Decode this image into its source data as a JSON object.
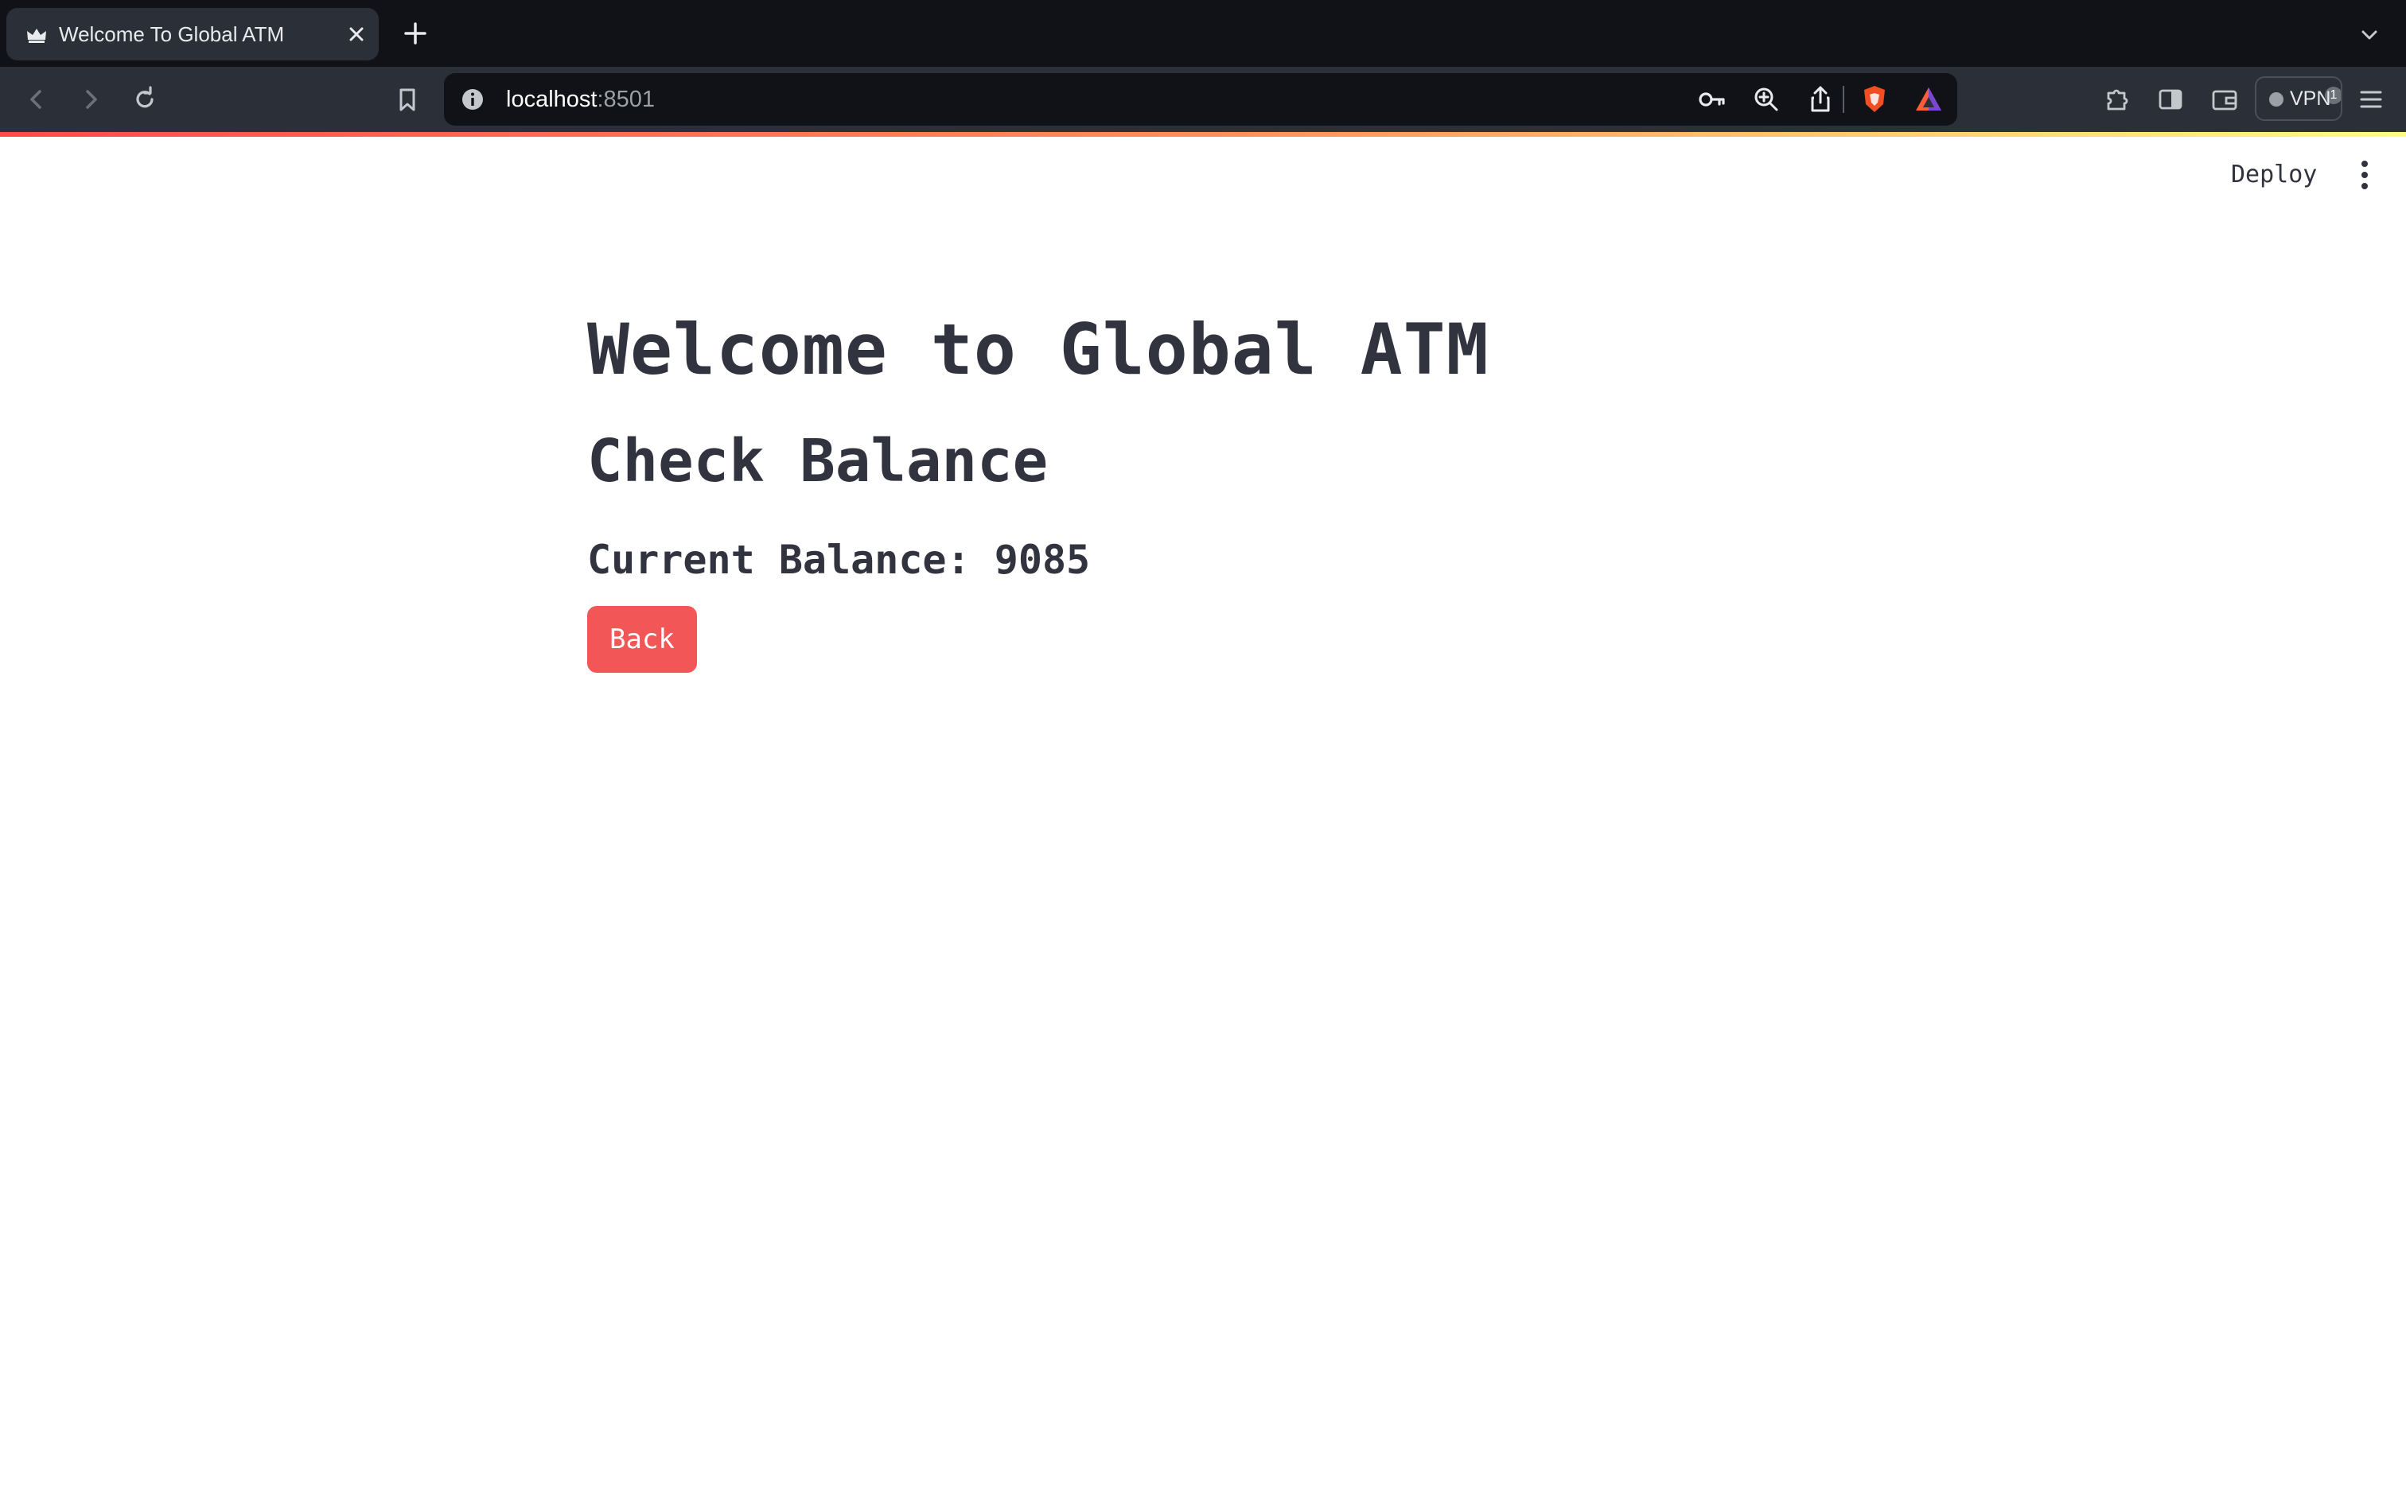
{
  "browser": {
    "tab": {
      "title": "Welcome To Global ATM"
    },
    "address_bar": {
      "host": "localhost",
      "port": ":8501"
    },
    "shields_badge_count": "1",
    "vpn_label": "VPN"
  },
  "header": {
    "deploy_label": "Deploy",
    "menu_icon": "vertical-dots-icon"
  },
  "main": {
    "title": "Welcome to Global ATM",
    "subheader": "Check Balance",
    "balance_text": "Current Balance: 9085",
    "back_button_label": "Back"
  },
  "colors": {
    "primary_button": "#f35656",
    "text": "#31333f",
    "tabstrip_bg": "#101217",
    "toolbar_bg": "#2b2f37"
  }
}
